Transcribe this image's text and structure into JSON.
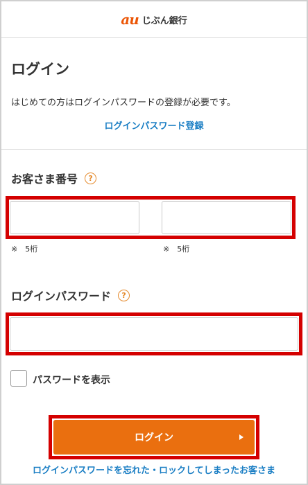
{
  "header": {
    "logo_mark": "au",
    "logo_text": "じぶん銀行"
  },
  "page": {
    "title": "ログイン",
    "intro": "はじめての方はログインパスワードの登録が必要です。",
    "register_link": "ログインパスワード登録"
  },
  "customer_number": {
    "label": "お客さま番号",
    "help": "?",
    "field1_value": "",
    "field2_value": "",
    "note1": "※　5桁",
    "note2": "※　5桁"
  },
  "password": {
    "label": "ログインパスワード",
    "help": "?",
    "value": ""
  },
  "show_password": {
    "label": "パスワードを表示",
    "checked": false
  },
  "login_button": {
    "label": "ログイン"
  },
  "forgot_link": "ログインパスワードを忘れた・ロックしてしまったお客さま",
  "colors": {
    "brand": "#eb5505",
    "button": "#ea6f0f",
    "link": "#1a7ec4",
    "highlight": "#d40000"
  }
}
